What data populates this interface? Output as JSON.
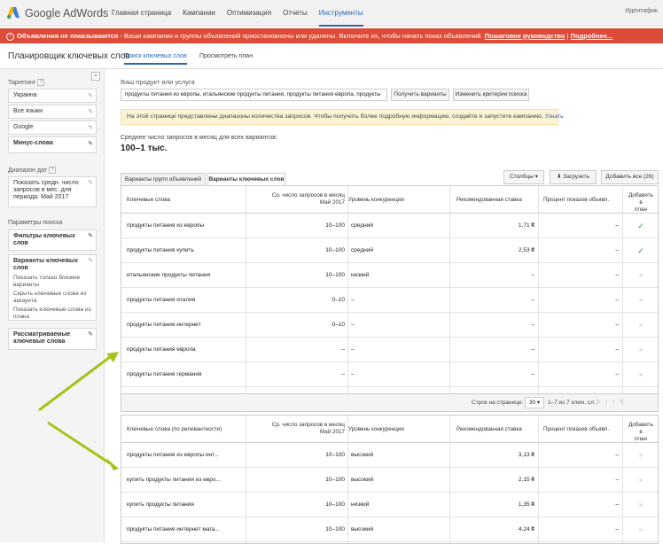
{
  "app": {
    "logo_text": "Google AdWords",
    "user_label": "Идентифик"
  },
  "nav": [
    "Главная страница",
    "Кампании",
    "Оптимизация",
    "Отчеты",
    "Инструменты"
  ],
  "alert": {
    "bold": "Объявления не показываются",
    "text": " - Ваши кампании и группы объявлений приостановлены или удалены. Включите их, чтобы начать показ объявлений.",
    "link1": "Пошаговое руководство",
    "sep": "|",
    "link2": "Подробнее..."
  },
  "header": {
    "title": "Планировщик ключевых слов",
    "tab1": "Поиск ключевых слов",
    "tab2": "Просмотреть план"
  },
  "sidebar": {
    "collapse": "«",
    "targeting_label": "Таргетинг",
    "targeting": [
      "Украина",
      "Все языки",
      "Google",
      "Минус-слова"
    ],
    "date_label": "Диапазон дат",
    "date_text": "Показать средн. число запросов в мес. для периода: Май 2017",
    "params_label": "Параметры поиска",
    "filters": "Фильтры ключевых слов",
    "variants_title": "Варианты ключевых слов",
    "variants_lines": [
      "Показать только близкие варианты",
      "Скрыть ключевые слова из аккаунта",
      "Показать ключевые слова из плана"
    ],
    "considered": "Рассматриваемые ключевые слова"
  },
  "search": {
    "label": "Ваш продукт или услуга",
    "value": "продукты питания из европы, итальянские продукты питания, продукты питания европа, продукты",
    "btn_get": "Получить варианты",
    "btn_criteria": "Изменить критерии поиска"
  },
  "info": {
    "text": "На этой странице представлены диапазоны количества запросов. Чтобы получить более подробную информацию, создайте и запустите кампанию.",
    "link": "Узнать"
  },
  "avg": {
    "label": "Среднее число запросов в месяц для всех вариантов:",
    "value": "100–1 тыс."
  },
  "tabs": {
    "groups": "Варианты групп объявлений",
    "keywords": "Варианты ключевых слов",
    "columns": "Столбцы ▾",
    "download": "Загрузить",
    "add_all": "Добавить все (26)"
  },
  "table1": {
    "headers": {
      "kw": "Ключевые слова",
      "avg1": "Ср. число запросов в месяц",
      "avg2": "Май 2017",
      "comp": "Уровень конкуренции",
      "bid": "Рекомендованная ставка",
      "share": "Процент показов объявл.",
      "add1": "Добавить в",
      "add2": "план"
    },
    "rows": [
      {
        "kw": "продукты питания из европы",
        "avg": "10–100",
        "comp": "средний",
        "bid": "1,71 ₴",
        "share": "–",
        "add": "✓"
      },
      {
        "kw": "продукты питания купить",
        "avg": "10–100",
        "comp": "средний",
        "bid": "2,53 ₴",
        "share": "–",
        "add": "✓"
      },
      {
        "kw": "итальянские продукты питания",
        "avg": "10–100",
        "comp": "низкий",
        "bid": "–",
        "share": "–",
        "add": "»"
      },
      {
        "kw": "продукты питания италия",
        "avg": "0–10",
        "comp": "–",
        "bid": "–",
        "share": "–",
        "add": "»"
      },
      {
        "kw": "продукты питания интернет",
        "avg": "0–10",
        "comp": "–",
        "bid": "–",
        "share": "–",
        "add": "»"
      },
      {
        "kw": "продукты питания европа",
        "avg": "–",
        "comp": "–",
        "bid": "–",
        "share": "–",
        "add": "»"
      },
      {
        "kw": "продукты питания германия",
        "avg": "–",
        "comp": "–",
        "bid": "–",
        "share": "–",
        "add": "»"
      }
    ]
  },
  "pager": {
    "label": "Строк на странице:",
    "size": "30 ▾",
    "range": "1–7 из 7 ключ. сл.",
    "nav": "|‹   ‹   ›   ›|"
  },
  "table2": {
    "headers": {
      "kw": "Ключевые слова (по релевантности)",
      "avg1": "Ср. число запросов в месяц",
      "avg2": "Май 2017",
      "comp": "Уровень конкуренции",
      "bid": "Рекомендованная ставка",
      "share": "Процент показов объявл.",
      "add1": "Добавить в",
      "add2": "план"
    },
    "rows": [
      {
        "kw": "продукты питания из европы инт...",
        "avg": "10–100",
        "comp": "высокий",
        "bid": "3,13 ₴",
        "share": "–",
        "add": "»"
      },
      {
        "kw": "купить продукты питания из евро...",
        "avg": "10–100",
        "comp": "высокий",
        "bid": "2,15 ₴",
        "share": "–",
        "add": "»"
      },
      {
        "kw": "купить продукты питания",
        "avg": "10–100",
        "comp": "низкий",
        "bid": "1,35 ₴",
        "share": "–",
        "add": "»"
      },
      {
        "kw": "продукты питания интернет мага...",
        "avg": "10–100",
        "comp": "высокий",
        "bid": "4,24 ₴",
        "share": "–",
        "add": "»"
      }
    ]
  },
  "colors": {
    "accent": "#2c66b8",
    "alert": "#dd4b39",
    "check": "#2a9d3a",
    "arrow": "#a9c11b"
  }
}
